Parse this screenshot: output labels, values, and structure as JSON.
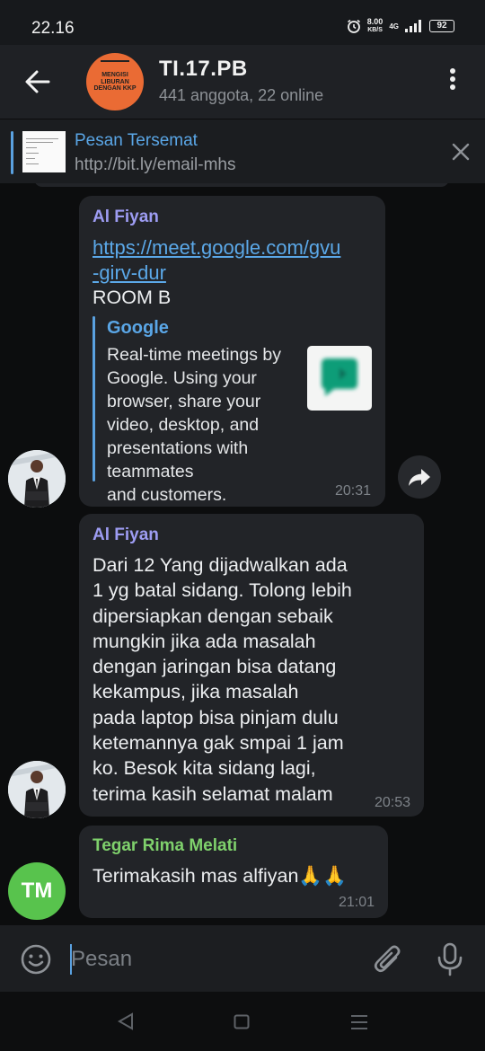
{
  "status": {
    "time": "22.16",
    "speed_value": "8.00",
    "speed_unit": "KB/S",
    "network": "4G",
    "battery": "92"
  },
  "header": {
    "title": "TI.17.PB",
    "subtitle": "441 anggota, 22 online",
    "avatar_text": "MENGISI LIBURAN DENGAN KKP"
  },
  "pinned": {
    "title": "Pesan Tersemat",
    "text": "http://bit.ly/email-mhs"
  },
  "messages": [
    {
      "sender": "Al Fiyan",
      "link": "https://meet.google.com/gvu\n-girv-dur",
      "text": "ROOM B",
      "preview_site": "Google",
      "preview_desc": "Real-time meetings by\nGoogle. Using your\nbrowser, share your\nvideo, desktop, and\npresentations with teammates\nand customers.",
      "time": "20:31"
    },
    {
      "sender": "Al Fiyan",
      "text": "Dari 12 Yang dijadwalkan ada\n1 yg batal sidang. Tolong lebih\ndipersiapkan dengan sebaik\nmungkin jika ada masalah\ndengan jaringan bisa datang\nkekampus, jika masalah\npada laptop bisa pinjam dulu\nketemannya gak smpai 1 jam\nko. Besok kita sidang lagi,\nterima kasih selamat malam",
      "time": "20:53"
    },
    {
      "sender": "Tegar Rima Melati",
      "avatar_initials": "TM",
      "text": "Terimakasih mas alfiyan🙏🙏",
      "time": "21:01"
    }
  ],
  "input": {
    "placeholder": "Pesan"
  },
  "colors": {
    "accent": "#5aa1e0",
    "sender_purple": "#9d9cf2",
    "sender_green": "#7fd16c",
    "bubble": "#222428",
    "header": "#1f2125",
    "avatar_green": "#58c34d",
    "group_avatar": "#ea6b34"
  }
}
